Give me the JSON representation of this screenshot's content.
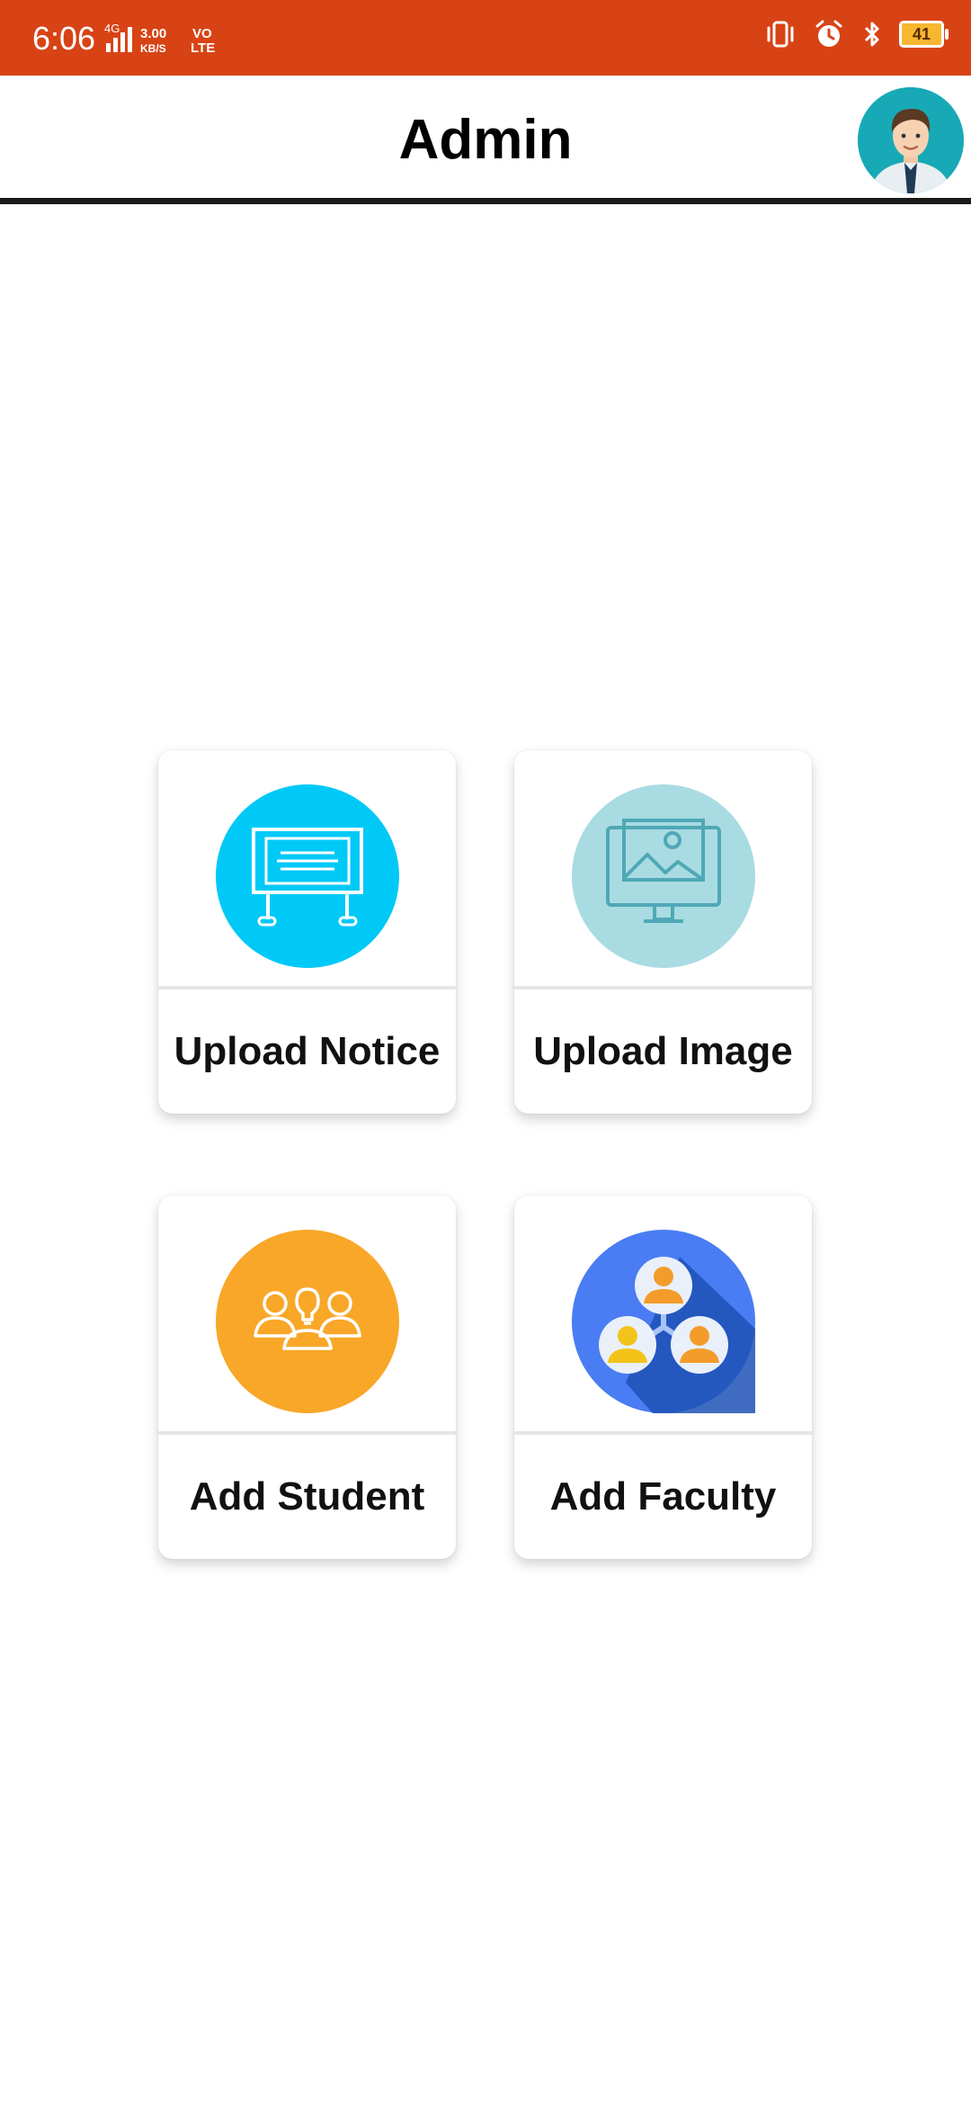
{
  "status_bar": {
    "time": "6:06",
    "network_text_top": "4G",
    "speed": "3.00",
    "speed_unit": "KB/S",
    "volte_top": "VO",
    "volte_bottom": "LTE",
    "battery_level": "41"
  },
  "app_bar": {
    "title": "Admin",
    "avatar": "male-user-avatar"
  },
  "colors": {
    "status_bar_bg": "#d84315",
    "notice_circle": "#00c9f7",
    "image_circle": "#a9dbe2",
    "student_circle": "#f9a728",
    "faculty_circle": "#4a7cf3"
  },
  "cards": [
    {
      "label": "Upload Notice",
      "icon": "notice-board-icon"
    },
    {
      "label": "Upload Image",
      "icon": "image-gallery-icon"
    },
    {
      "label": "Add Student",
      "icon": "students-idea-icon"
    },
    {
      "label": "Add Faculty",
      "icon": "faculty-network-icon"
    }
  ]
}
